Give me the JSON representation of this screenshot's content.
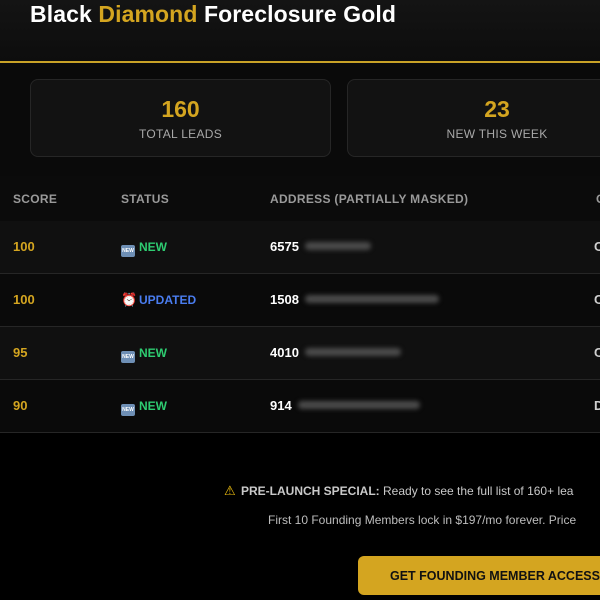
{
  "header": {
    "title_part1": "Black ",
    "title_part2": "Diamond",
    "title_part3": " Foreclosure Gold",
    "accent_color": "#d4a520"
  },
  "stats": [
    {
      "value": "160",
      "label": "TOTAL LEADS"
    },
    {
      "value": "23",
      "label": "NEW THIS WEEK"
    }
  ],
  "table": {
    "columns": [
      "SCORE",
      "STATUS",
      "ADDRESS (PARTIALLY MASKED)",
      "C"
    ],
    "rows": [
      {
        "score": "100",
        "status": "NEW",
        "status_icon": "new-icon",
        "address": "6575",
        "edge": "C"
      },
      {
        "score": "100",
        "status": "UPDATED",
        "status_icon": "alarm-clock-icon",
        "address": "1508",
        "edge": "C"
      },
      {
        "score": "95",
        "status": "NEW",
        "status_icon": "new-icon",
        "address": "4010",
        "edge": "C"
      },
      {
        "score": "90",
        "status": "NEW",
        "status_icon": "new-icon",
        "address": "914",
        "edge": "D"
      }
    ]
  },
  "promo": {
    "heading": "PRE-LAUNCH SPECIAL:",
    "line1_rest": " Ready to see the full list of 160+ lea",
    "line2": "First 10 Founding Members lock in $197/mo forever. Price",
    "cta_label": "GET FOUNDING MEMBER ACCESS"
  },
  "icon_glyphs": {
    "new_badge_text": "NEW",
    "clock": "⏰",
    "warning": "⚠"
  },
  "colors": {
    "new_status": "#2ecc71",
    "updated_status": "#4a7df0",
    "gold": "#d4a520"
  }
}
